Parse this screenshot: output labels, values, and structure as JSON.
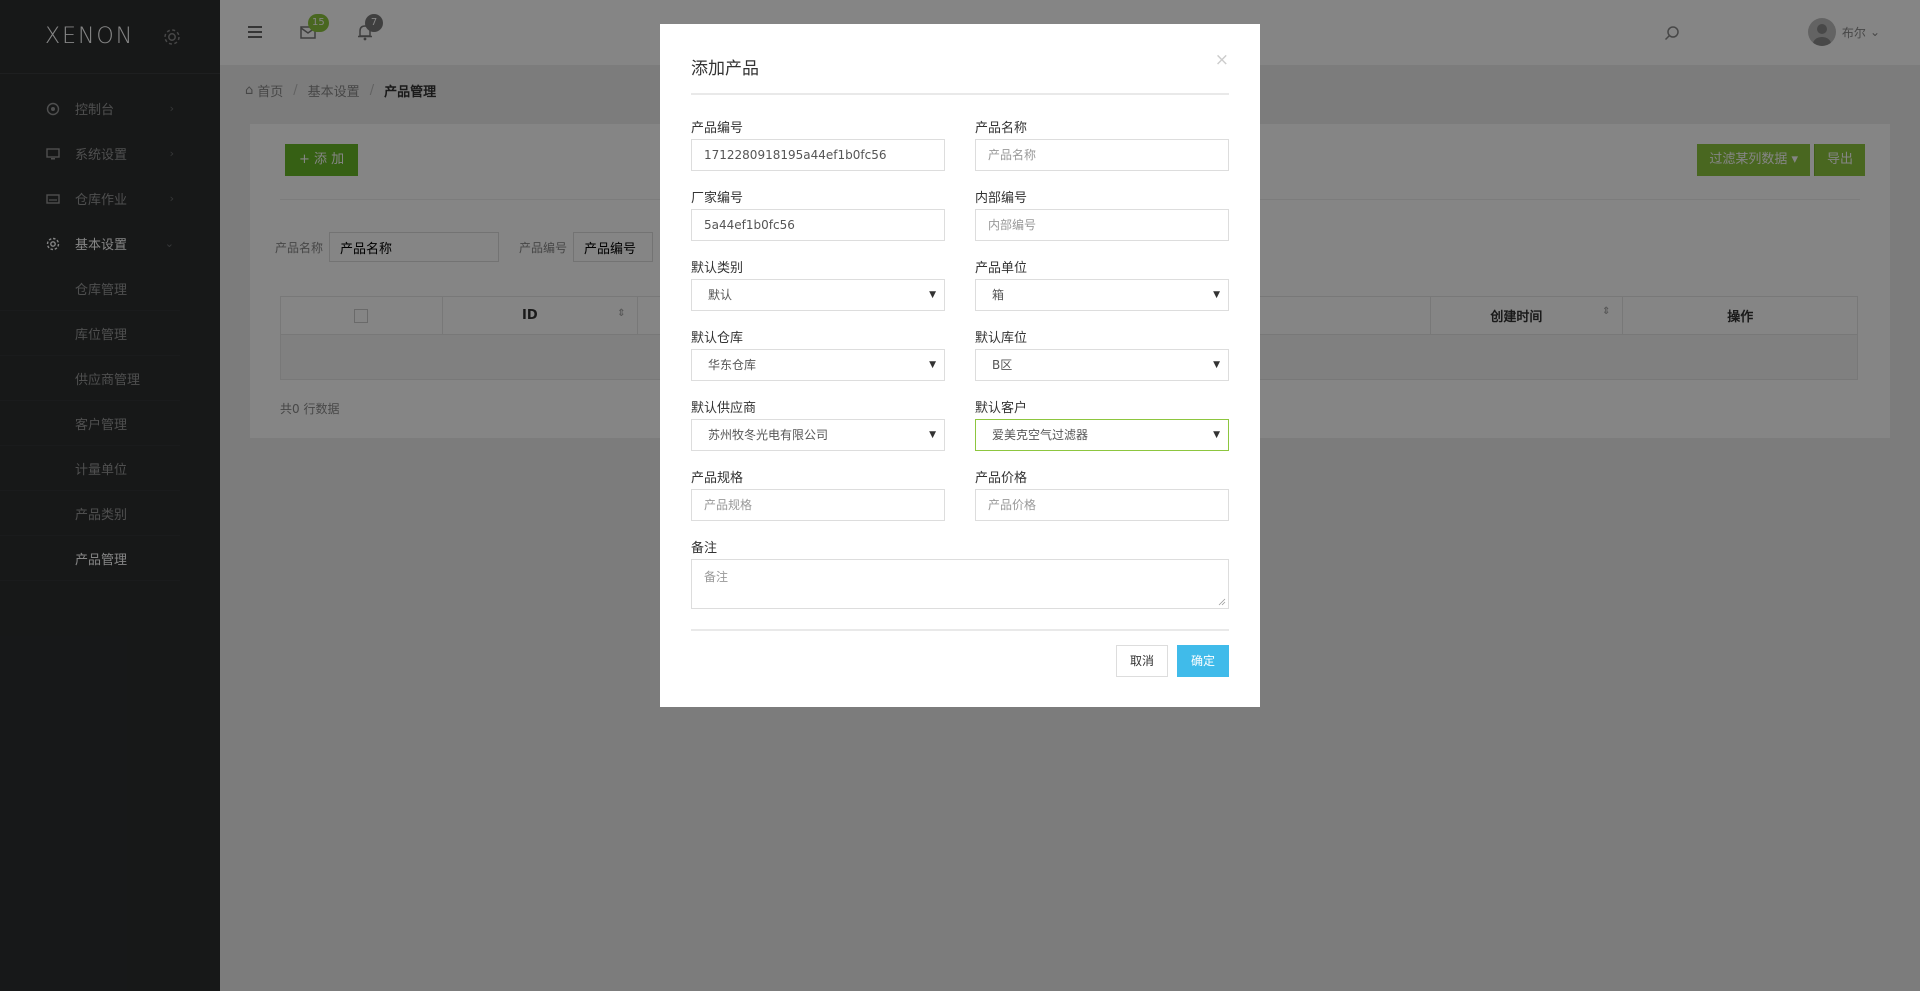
{
  "app": {
    "logo": "XENON"
  },
  "sidebar": {
    "items": [
      {
        "label": "控制台",
        "icon": "gauge-icon"
      },
      {
        "label": "系统设置",
        "icon": "monitor-icon"
      },
      {
        "label": "仓库作业",
        "icon": "drive-icon"
      },
      {
        "label": "基本设置",
        "icon": "gear-icon"
      }
    ],
    "subitems": [
      "仓库管理",
      "库位管理",
      "供应商管理",
      "客户管理",
      "计量单位",
      "产品类别",
      "产品管理"
    ]
  },
  "topbar": {
    "mail_count": "15",
    "notify_count": "7",
    "user_name": "布尔"
  },
  "breadcrumb": {
    "home": "首页",
    "section": "基本设置",
    "current": "产品管理"
  },
  "page": {
    "add_button": "添 加",
    "filter_button": "过滤某列数据",
    "export_button": "导出",
    "filter_name_label": "产品名称",
    "filter_name_value": "产品名称",
    "filter_code_label": "产品编号",
    "filter_code_value": "产品编号",
    "table_headers": {
      "id": "ID",
      "created": "创建时间",
      "ops": "操作"
    },
    "row_count": "共0 行数据"
  },
  "modal": {
    "title": "添加产品",
    "close": "×",
    "fields": {
      "product_code": {
        "label": "产品编号",
        "value": "1712280918195a44ef1b0fc56"
      },
      "product_name": {
        "label": "产品名称",
        "placeholder": "产品名称"
      },
      "factory_code": {
        "label": "厂家编号",
        "value": "5a44ef1b0fc56"
      },
      "internal_code": {
        "label": "内部编号",
        "placeholder": "内部编号"
      },
      "category": {
        "label": "默认类别",
        "value": "默认"
      },
      "unit": {
        "label": "产品单位",
        "value": "箱"
      },
      "warehouse": {
        "label": "默认仓库",
        "value": "华东仓库"
      },
      "location": {
        "label": "默认库位",
        "value": "B区"
      },
      "supplier": {
        "label": "默认供应商",
        "value": "苏州牧冬光电有限公司"
      },
      "customer": {
        "label": "默认客户",
        "value": "爱美克空气过滤器"
      },
      "spec": {
        "label": "产品规格",
        "placeholder": "产品规格"
      },
      "price": {
        "label": "产品价格",
        "placeholder": "产品价格"
      },
      "remark": {
        "label": "备注",
        "placeholder": "备注"
      }
    },
    "cancel": "取消",
    "ok": "确定"
  },
  "colors": {
    "sidebar_bg": "#2c2e2f",
    "accent_green": "#8dc63f",
    "ok_blue": "#40bbea"
  }
}
